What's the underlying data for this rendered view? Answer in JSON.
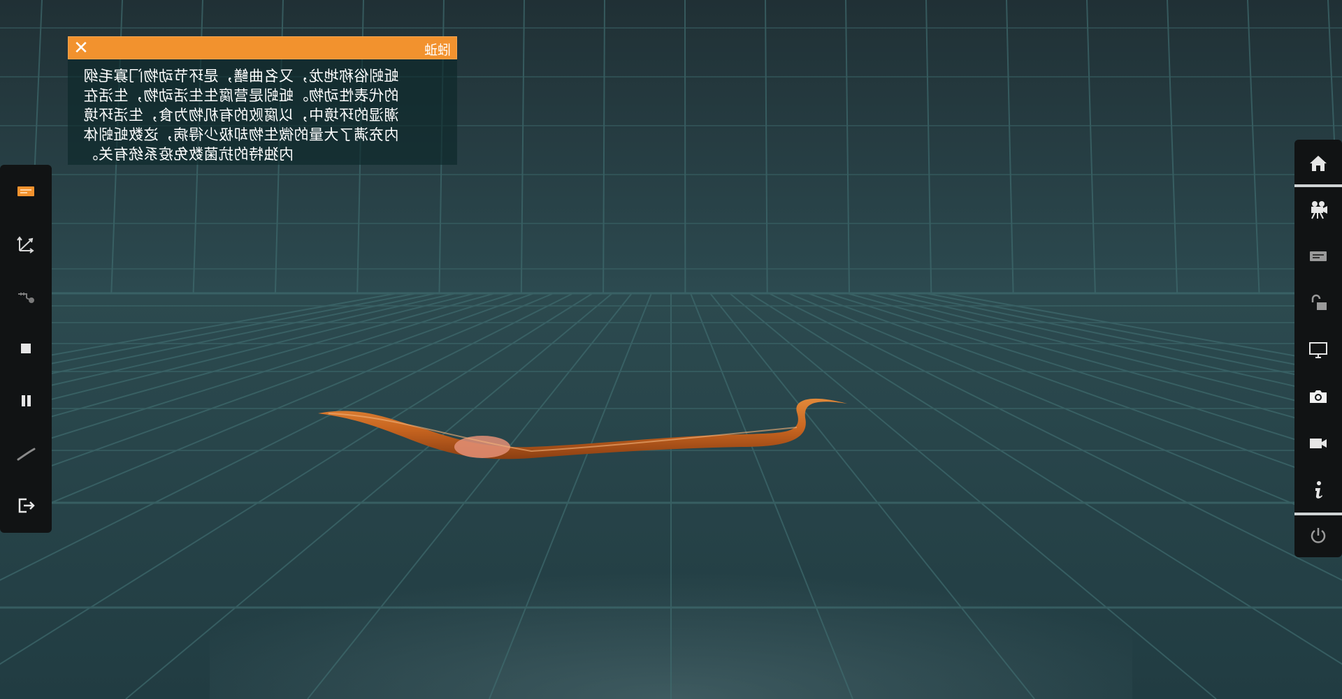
{
  "info_panel": {
    "title": "蚯蚓",
    "close_icon": "close-icon",
    "lines": [
      "蚯蚓俗称地龙，又名曲鳝，是环节动物门寡毛纲",
      "的代表性动物。蚯蚓是营腐生生活动物，生活在",
      "潮湿的环境中，以腐败的有机物为食，生活环境",
      "内充满了大量的微生物却极少得病，这数蚯蚓体",
      "内独特的抗菌数免疫系统有关。"
    ],
    "accent_color": "#f2922e"
  },
  "left_toolbar": {
    "items": [
      {
        "name": "info-icon",
        "active": true
      },
      {
        "name": "axis-icon"
      },
      {
        "name": "knife-icon"
      },
      {
        "name": "stop-icon"
      },
      {
        "name": "pause-icon"
      },
      {
        "name": "scalpel-icon"
      },
      {
        "name": "exit-icon"
      }
    ]
  },
  "right_toolbar": {
    "items": [
      {
        "name": "home-icon"
      },
      {
        "name": "movie-camera-icon"
      },
      {
        "name": "subtitle-icon"
      },
      {
        "name": "unlock-icon"
      },
      {
        "name": "monitor-icon"
      },
      {
        "name": "camera-icon"
      },
      {
        "name": "video-icon"
      },
      {
        "name": "help-icon"
      },
      {
        "name": "power-icon"
      }
    ]
  }
}
